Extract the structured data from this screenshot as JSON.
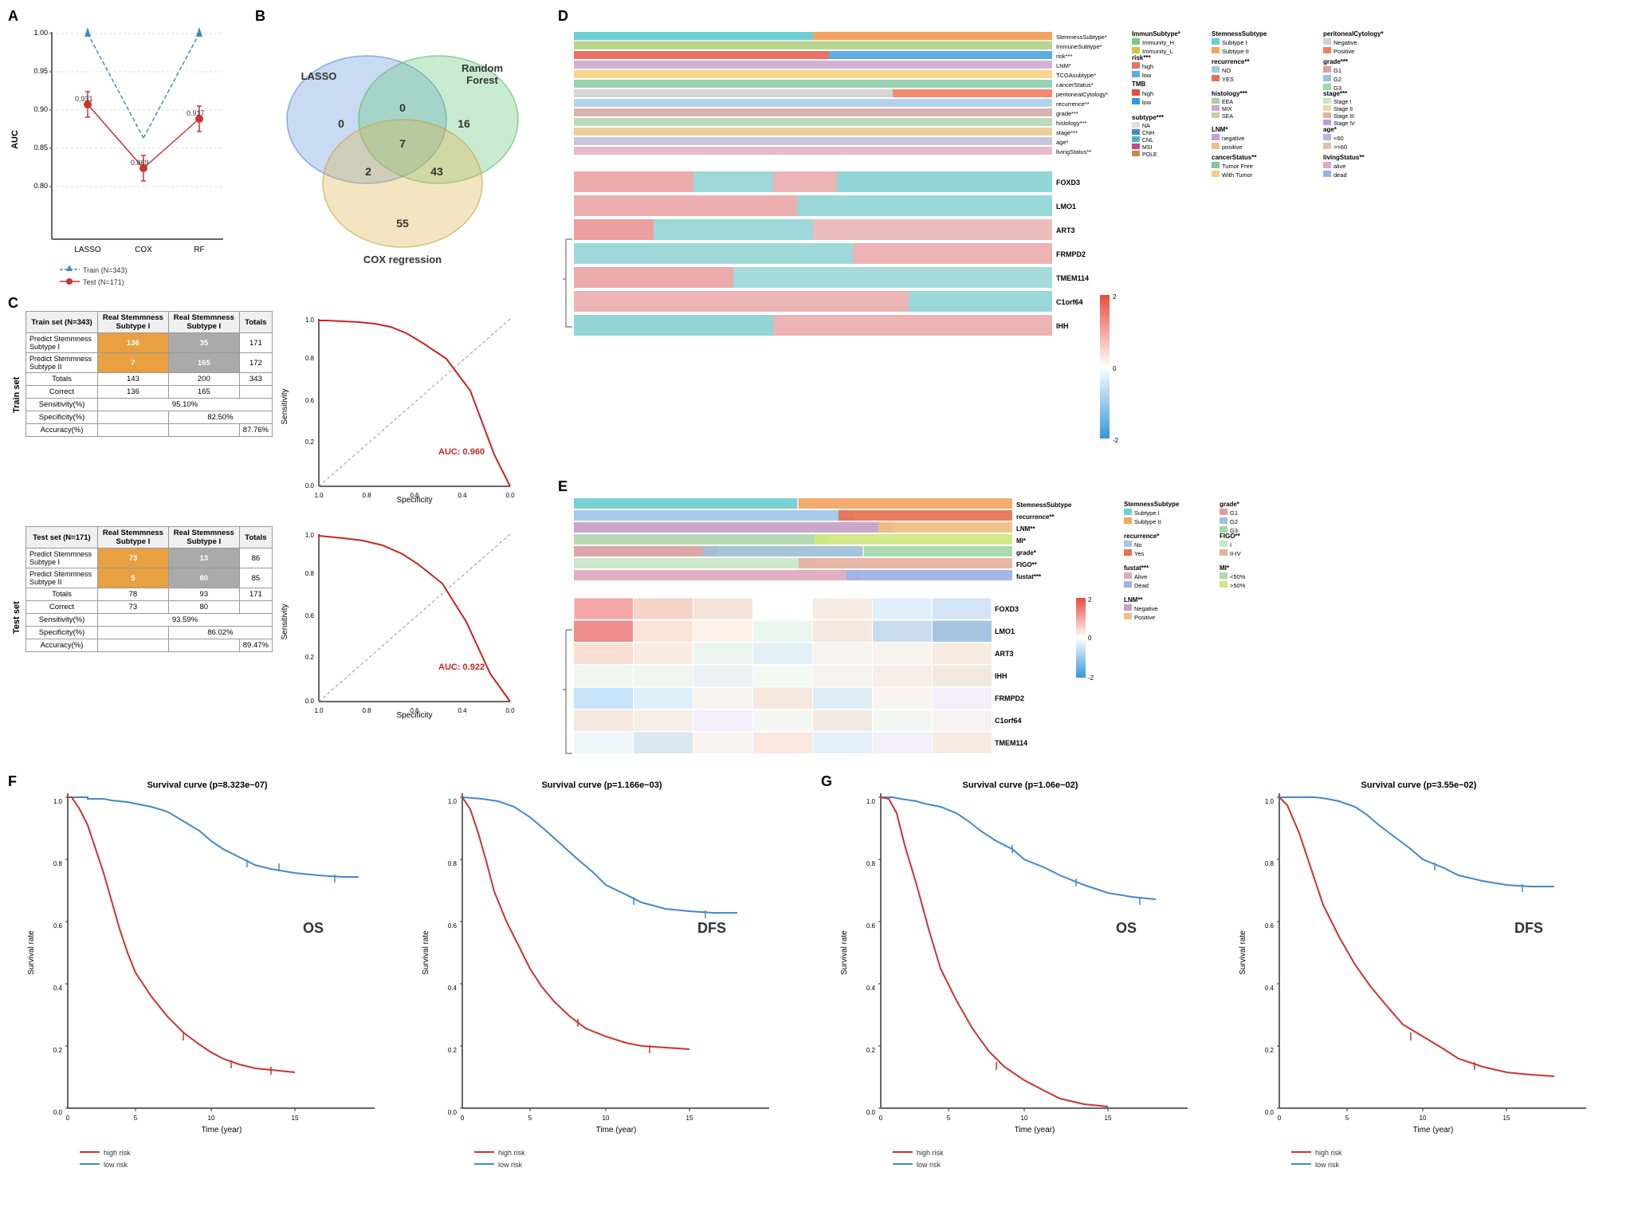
{
  "panels": {
    "a": {
      "label": "A",
      "title": "",
      "y_axis": "AUC",
      "x_labels": [
        "LASSO",
        "COX",
        "RF"
      ],
      "train_values": [
        1.0,
        0.869,
        1.0
      ],
      "test_values": [
        0.931,
        0.869,
        0.917
      ],
      "train_label": "Train (N=343)",
      "test_label": "Test (N=171)",
      "annotations": [
        "0.931",
        "0.869",
        "0.917"
      ]
    },
    "b": {
      "label": "B",
      "sets": [
        "LASSO",
        "Random Forest",
        "COX regression"
      ],
      "numbers": {
        "lasso_only": 0,
        "rf_only": 16,
        "cox_only": 55,
        "lasso_rf": 0,
        "lasso_cox": 2,
        "rf_cox": 43,
        "all_three": 7
      }
    },
    "c": {
      "label": "C",
      "train_section": "Train set",
      "test_section": "Test set",
      "train_table": {
        "title": "Train set (N=343)",
        "col1": "Real Stemmness Subtype I",
        "col2": "Real Stemmness Subtype I",
        "col3": "Totals",
        "row1_label": "Predict Stemmness Subtype I",
        "row1_v1": 136,
        "row1_v2": 35,
        "row1_total": 171,
        "row2_label": "Predict Stemmness Subtype II",
        "row2_v1": 7,
        "row2_v2": 165,
        "row2_total": 172,
        "row3_label": "Totals",
        "row3_v1": 143,
        "row3_v2": 200,
        "row3_total": 343,
        "correct_label": "Correct",
        "correct_v1": 136,
        "correct_v2": 165,
        "sensitivity": "95.10%",
        "specificity": "82.50%",
        "accuracy": "87.76%"
      },
      "test_table": {
        "title": "Test set (N=171)",
        "row1_label": "Predict Stemmness Subtype I",
        "row1_v1": 73,
        "row1_v2": 13,
        "row1_total": 86,
        "row2_label": "Predict Stemmness Subtype II",
        "row2_v1": 5,
        "row2_v2": 80,
        "row2_total": 85,
        "row3_v1": 78,
        "row3_v2": 93,
        "row3_total": 171,
        "correct_v1": 73,
        "correct_v2": 80,
        "sensitivity": "93.59%",
        "specificity": "86.02%",
        "accuracy": "89.47%"
      },
      "roc_train_auc": "AUC: 0.960",
      "roc_test_auc": "AUC: 0.922"
    },
    "d": {
      "label": "D",
      "genes": [
        "FOXD3",
        "LMO1",
        "ART3",
        "FRMPD2",
        "TMEM114",
        "C1orf64",
        "IHH"
      ],
      "legend_groups": {
        "StemnessSubtype": [
          "Subtype I",
          "Subtype II"
        ],
        "peritonealCytology": [
          "Negative",
          "Positive"
        ],
        "recurrence": [
          "NO",
          "YES"
        ],
        "grade": [
          "G1",
          "G2",
          "G3"
        ],
        "ImmunSubtype": [
          "Immunity_H",
          "Immunity_L"
        ],
        "histology": [
          "EEA",
          "MIX",
          "SEA"
        ],
        "subtype": [
          "NA",
          "CNH",
          "CNL",
          "MSI",
          "POLE"
        ],
        "stage": [
          "Stage I",
          "Stage II",
          "Stage III",
          "Stage IV"
        ],
        "LNM": [
          "negative",
          "positive"
        ],
        "age": [
          "<60",
          ">=60"
        ],
        "cancerStatus": [
          "Tumor Free",
          "With Tumor"
        ],
        "livingStatus": [
          "alive",
          "dead"
        ],
        "TMB": [
          "high",
          "low"
        ],
        "risk": [
          "high",
          "low"
        ]
      }
    },
    "e": {
      "label": "E",
      "genes": [
        "FOXD3",
        "LMO1",
        "ART3",
        "IHH",
        "FRMPD2",
        "C1orf64",
        "TMEM114"
      ],
      "row_labels": [
        "StemnessSubtype",
        "recurrence**",
        "LNM**",
        "MI*",
        "grade*",
        "FIGO**",
        "fustat***"
      ],
      "legend": {
        "StemnessSubtype": [
          "Subtype I",
          "Subtype II"
        ],
        "grade": [
          "G1",
          "G2",
          "G3"
        ],
        "recurrence": [
          "No",
          "Yes"
        ],
        "FIGO": [
          "I",
          "II-IV"
        ],
        "fustat": [
          "Alive",
          "Dead"
        ],
        "LNM": [
          "Negative",
          "Positive"
        ],
        "MI": [
          "<50%",
          ">50%"
        ]
      }
    },
    "f": {
      "label": "F",
      "charts": [
        {
          "title": "Survival curve (p=8.323e−07)",
          "curve_label": "OS",
          "x_label": "Time (year)",
          "y_label": "Survival rate",
          "legend": [
            "high risk",
            "low risk"
          ]
        },
        {
          "title": "Survival curve (p=1.166e−03)",
          "curve_label": "DFS",
          "x_label": "Time (year)",
          "y_label": "Survival rate",
          "legend": [
            "high risk",
            "low risk"
          ]
        }
      ]
    },
    "g": {
      "label": "G",
      "charts": [
        {
          "title": "Survival curve (p=1.06e−02)",
          "curve_label": "OS",
          "x_label": "Time (year)",
          "y_label": "Survival rate",
          "legend": [
            "high risk",
            "low risk"
          ]
        },
        {
          "title": "Survival curve (p=3.55e−02)",
          "curve_label": "DFS",
          "x_label": "Time (year)",
          "y_label": "Survival rate",
          "legend": [
            "high risk",
            "low risk"
          ]
        }
      ]
    }
  }
}
